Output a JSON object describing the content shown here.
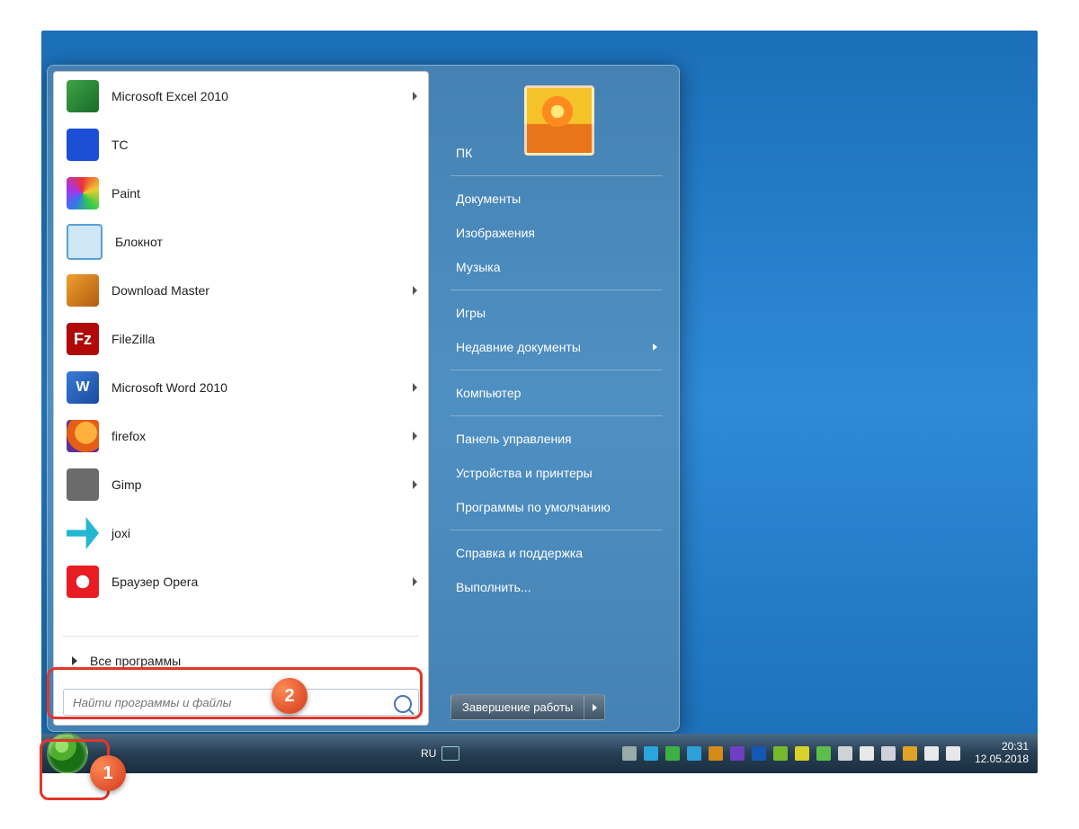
{
  "programs": [
    {
      "label": "Microsoft Excel 2010",
      "icon": "excel-icon",
      "cls": "c-excel",
      "arrow": true
    },
    {
      "label": "TC",
      "icon": "tc-icon",
      "cls": "c-tc",
      "arrow": false
    },
    {
      "label": "Paint",
      "icon": "paint-icon",
      "cls": "c-paint",
      "arrow": false
    },
    {
      "label": "Блокнот",
      "icon": "notepad-icon",
      "cls": "c-note",
      "arrow": false
    },
    {
      "label": "Download Master",
      "icon": "download-master-icon",
      "cls": "c-dm",
      "arrow": true
    },
    {
      "label": "FileZilla",
      "icon": "filezilla-icon",
      "cls": "c-fz",
      "arrow": false,
      "glyph": "Fz"
    },
    {
      "label": "Microsoft Word 2010",
      "icon": "word-icon",
      "cls": "c-word",
      "arrow": true,
      "glyph": "W"
    },
    {
      "label": "firefox",
      "icon": "firefox-icon",
      "cls": "c-ff",
      "arrow": true
    },
    {
      "label": "Gimp",
      "icon": "gimp-icon",
      "cls": "c-gimp",
      "arrow": true
    },
    {
      "label": "joxi",
      "icon": "joxi-icon",
      "cls": "c-joxi",
      "arrow": false
    },
    {
      "label": "Браузер Opera",
      "icon": "opera-icon",
      "cls": "c-opera",
      "arrow": true
    }
  ],
  "all_programs": "Все программы",
  "search_placeholder": "Найти программы и файлы",
  "right_links": [
    {
      "label": "ПК",
      "sep": false
    },
    {
      "label": "Документы",
      "sep": true
    },
    {
      "label": "Изображения",
      "sep": false
    },
    {
      "label": "Музыка",
      "sep": false
    },
    {
      "label": "Игры",
      "sep": true
    },
    {
      "label": "Недавние документы",
      "sep": false,
      "arrow": true
    },
    {
      "label": "Компьютер",
      "sep": true
    },
    {
      "label": "Панель управления",
      "sep": true
    },
    {
      "label": "Устройства и принтеры",
      "sep": false
    },
    {
      "label": "Программы по умолчанию",
      "sep": false
    },
    {
      "label": "Справка и поддержка",
      "sep": true
    },
    {
      "label": "Выполнить...",
      "sep": false
    }
  ],
  "shutdown": "Завершение работы",
  "taskbar": {
    "lang": "RU",
    "tray_icons": [
      "up-icon",
      "skype-icon",
      "check-icon",
      "telegram-icon",
      "app1-icon",
      "app2-icon",
      "disk-icon",
      "utorrent-icon",
      "app3-icon",
      "signal-icon",
      "app4-icon",
      "flag-icon",
      "shield-icon",
      "update-icon",
      "network-icon",
      "volume-icon"
    ],
    "tray_colors": [
      "#9aa",
      "#29a6dd",
      "#3bb143",
      "#2da0d8",
      "#d68a1a",
      "#6f3fc2",
      "#1458b3",
      "#76b92b",
      "#d7d12a",
      "#5bbf4a",
      "#cfd3d8",
      "#e8e8e8",
      "#cfd3d8",
      "#e0a326",
      "#e8e8e8",
      "#e8e8e8"
    ],
    "time": "20:31",
    "date": "12.05.2018"
  },
  "callouts": {
    "b1": "1",
    "b2": "2"
  }
}
